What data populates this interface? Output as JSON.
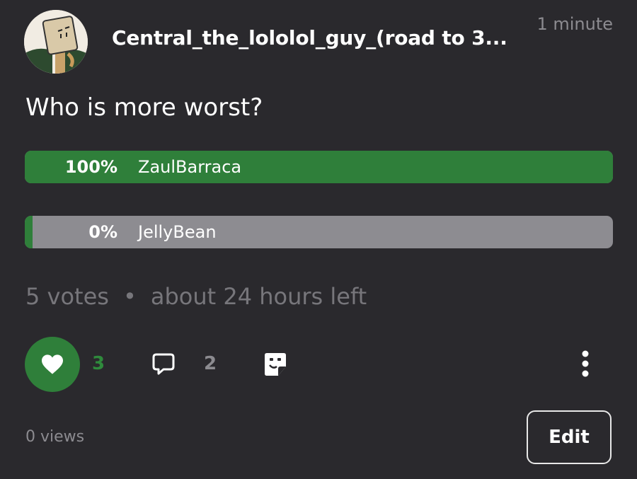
{
  "post": {
    "username": "Central_the_lololol_guy_(road to 3...",
    "timestamp": "1 minute",
    "question": "Who is more worst?"
  },
  "poll": {
    "options": [
      {
        "percent_text": "100%",
        "label": "ZaulBarraca",
        "fraction": 1.0
      },
      {
        "percent_text": "0%",
        "label": "JellyBean",
        "fraction": 0.0
      }
    ],
    "votes": "5 votes",
    "separator": "•",
    "time_left": "about 24 hours left"
  },
  "actions": {
    "like_count": "3",
    "comment_count": "2"
  },
  "footer": {
    "views": "0 views",
    "edit_label": "Edit"
  },
  "colors": {
    "background": "#2a292d",
    "accent_green": "#2f7f3a",
    "bar_track": "#8d8c91",
    "muted_text": "#77767b"
  }
}
